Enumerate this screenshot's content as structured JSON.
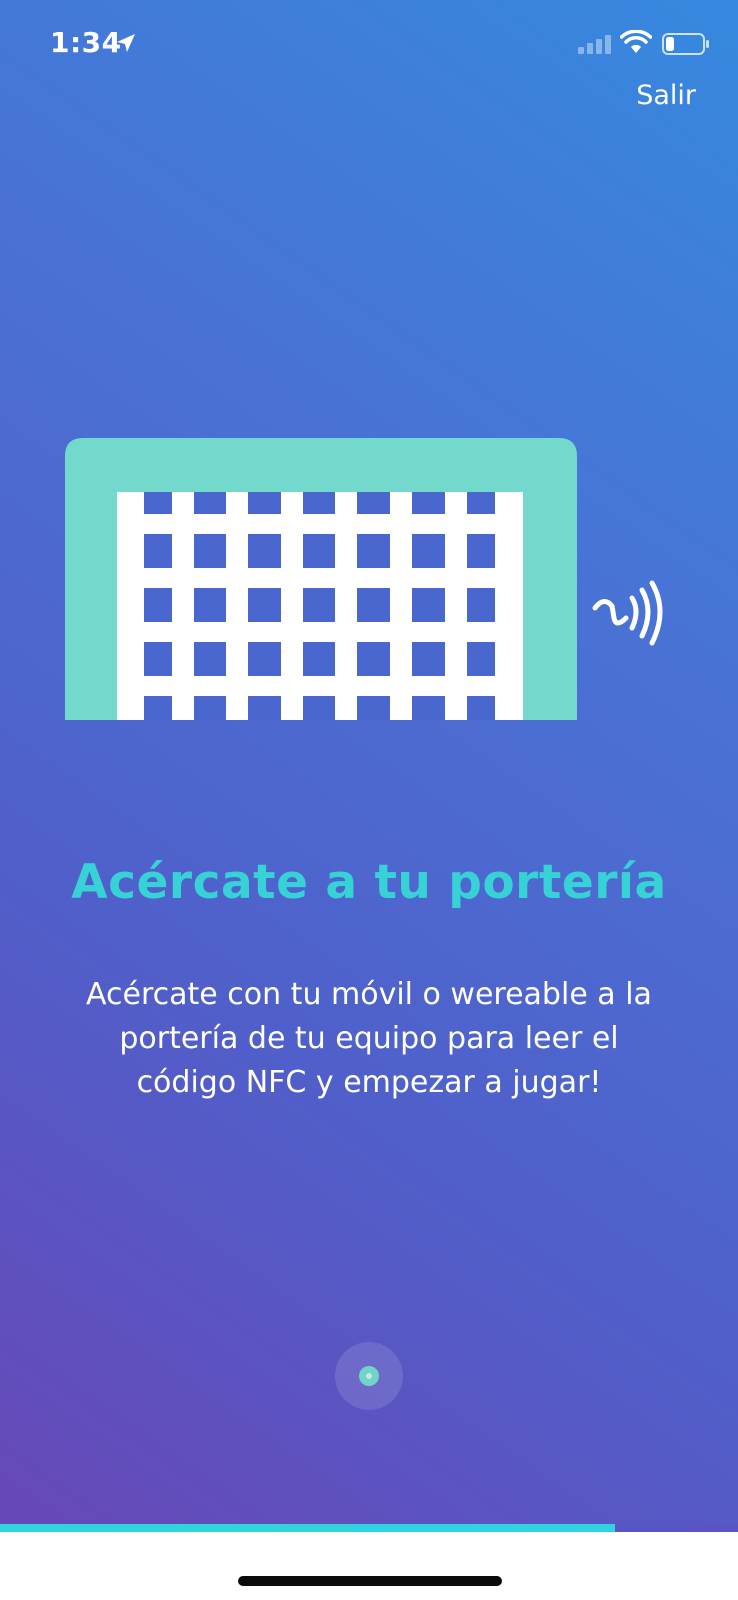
{
  "status_bar": {
    "time": "1:34",
    "location_icon": "location-arrow-icon",
    "signal_icon": "cellular-signal-icon",
    "wifi_icon": "wifi-icon",
    "battery_icon": "battery-icon"
  },
  "header": {
    "exit_label": "Salir"
  },
  "illustration": {
    "goal_icon": "soccer-goal-icon",
    "nfc_icon": "nfc-icon",
    "goal_color": "#72d9cc",
    "net_color": "#ffffff"
  },
  "content": {
    "title": "Acércate a tu portería",
    "description": "Acércate con tu móvil o wereable a la portería de tu equipo para leer el código NFC y empezar a jugar!"
  },
  "pager": {
    "current_page": 1,
    "total_pages": 1
  },
  "progress": {
    "fraction": 0.833
  },
  "colors": {
    "title": "#36d2d6",
    "progress": "#2fd4df",
    "gradient_top": "#3689e0",
    "gradient_bottom": "#6a45b5"
  }
}
